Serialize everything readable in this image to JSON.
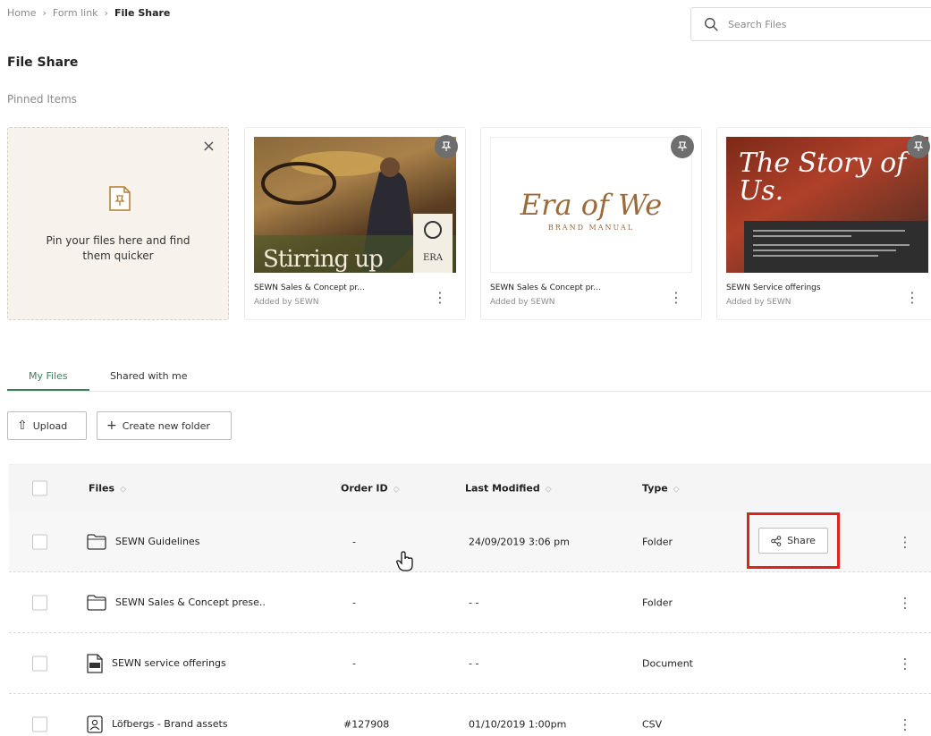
{
  "breadcrumb": [
    "Home",
    "Form link",
    "File Share"
  ],
  "search": {
    "placeholder": "Search Files"
  },
  "page_title": "File Share",
  "pinned": {
    "label": "Pinned Items",
    "drop_message": "Pin your files here and find them quicker",
    "cards": [
      {
        "name": "SEWN Sales & Concept pr...",
        "added_by": "Added by SEWN",
        "thumb_text": "Stirring up"
      },
      {
        "name": "SEWN Sales & Concept pr...",
        "added_by": "Added by SEWN",
        "thumb_text": "Era of We",
        "thumb_sub": "BRAND MANUAL"
      },
      {
        "name": "SEWN Service offerings",
        "added_by": "Added by SEWN",
        "thumb_text": "The Story of Us."
      }
    ]
  },
  "tabs": [
    {
      "label": "My Files",
      "active": true
    },
    {
      "label": "Shared with me",
      "active": false
    }
  ],
  "actions": {
    "upload": "Upload",
    "create_folder": "Create new folder"
  },
  "table": {
    "columns": [
      "Files",
      "Order ID",
      "Last Modified",
      "Type"
    ],
    "rows": [
      {
        "name": "SEWN Guidelines",
        "order_id": "-",
        "modified": "24/09/2019  3:06 pm",
        "type": "Folder",
        "icon": "folder-icon"
      },
      {
        "name": "SEWN Sales & Concept prese..",
        "order_id": "-",
        "modified": "- -",
        "type": "Folder",
        "icon": "folder-icon"
      },
      {
        "name": "SEWN service offerings",
        "order_id": "-",
        "modified": "- -",
        "type": "Document",
        "icon": "pdf-icon"
      },
      {
        "name": "Löfbergs - Brand assets",
        "order_id": "#127908",
        "modified": "01/10/2019  1:00pm",
        "type": "CSV",
        "icon": "contact-file-icon"
      }
    ],
    "share_label": "Share"
  },
  "colors": {
    "accent": "#3f7f5b",
    "highlight": "#e0221f"
  }
}
